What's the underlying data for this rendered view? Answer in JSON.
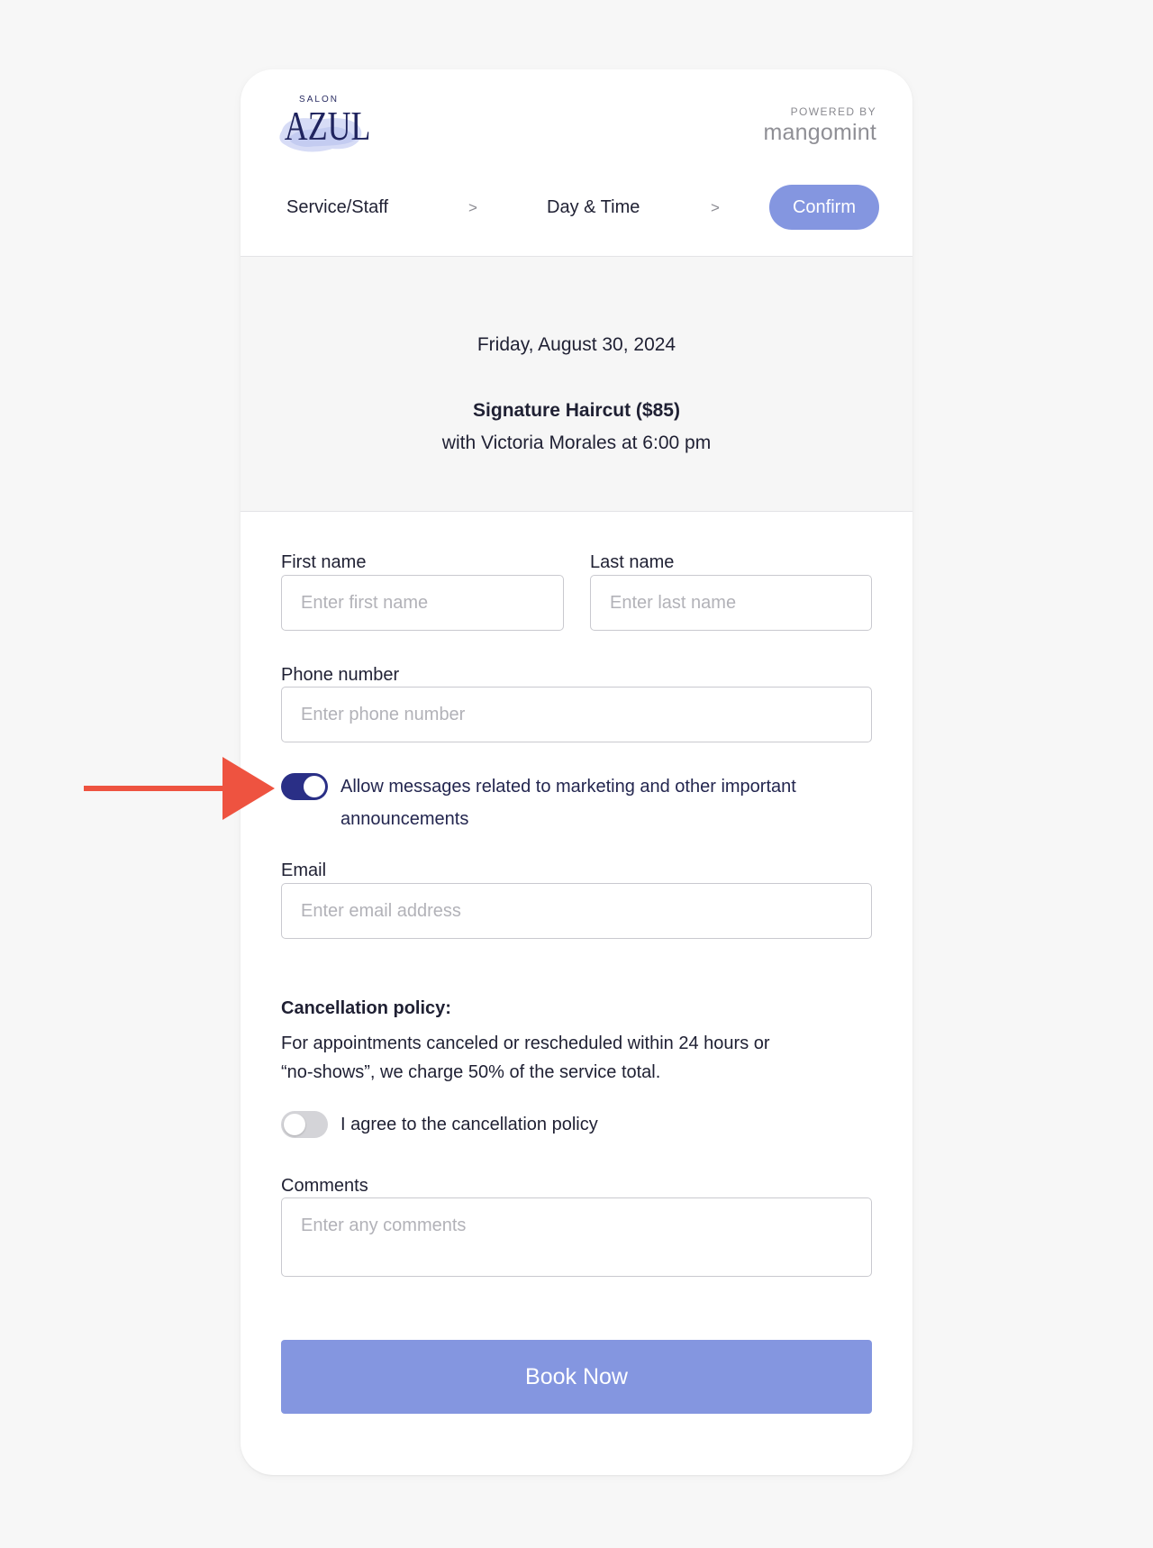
{
  "brand": {
    "salon_small": "SALON",
    "salon_name": "AZUL",
    "powered_by": "POWERED BY",
    "platform": "mangomint"
  },
  "steps": {
    "service_staff": "Service/Staff",
    "separator": ">",
    "day_time": "Day & Time",
    "confirm": "Confirm"
  },
  "summary": {
    "date": "Friday, August 30, 2024",
    "service": "Signature Haircut ($85)",
    "with": "with Victoria Morales at 6:00 pm"
  },
  "form": {
    "first_name_label": "First name",
    "first_name_placeholder": "Enter first name",
    "last_name_label": "Last name",
    "last_name_placeholder": "Enter last name",
    "phone_label": "Phone number",
    "phone_placeholder": "Enter phone number",
    "marketing_toggle_on": true,
    "marketing_line1": "Allow messages related to marketing and other important",
    "marketing_line2": "announcements",
    "email_label": "Email",
    "email_placeholder": "Enter email address",
    "policy_title": "Cancellation policy:",
    "policy_line1": "For appointments canceled or rescheduled within 24 hours or",
    "policy_line2": "“no-shows”, we charge 50% of the service total.",
    "agree_toggle_on": false,
    "agree_text": "I agree to the cancellation policy",
    "comments_label": "Comments",
    "comments_placeholder": "Enter any comments",
    "book_button": "Book Now"
  },
  "colors": {
    "accent": "#8496e0",
    "toggle_on": "#2a2f86",
    "annotation_arrow": "#ee5340"
  }
}
